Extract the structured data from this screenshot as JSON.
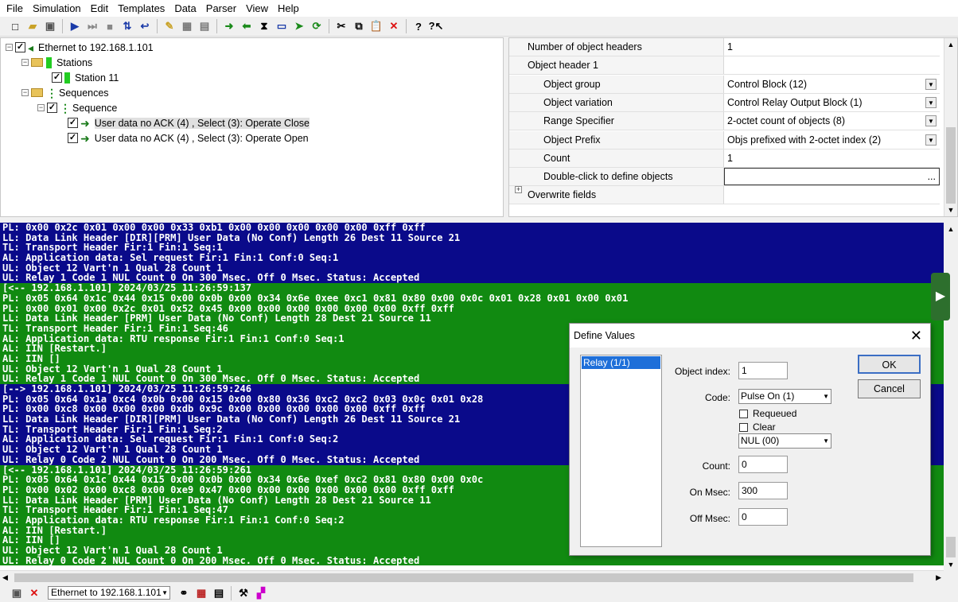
{
  "menu": [
    "File",
    "Simulation",
    "Edit",
    "Templates",
    "Data",
    "Parser",
    "View",
    "Help"
  ],
  "toolbar_icons": [
    "new-icon",
    "open-icon",
    "save-icon",
    "play-icon",
    "step-icon",
    "stop-icon",
    "sort-icon",
    "loop-icon",
    "tool-icon",
    "grid-icon",
    "grid2-icon",
    "go-right-icon",
    "go-left-icon",
    "hourglass-icon",
    "monitor-icon",
    "go-icon",
    "refresh-icon",
    "cut-icon",
    "copy-icon",
    "paste-icon",
    "delete-icon",
    "help-icon",
    "whatsthis-icon"
  ],
  "tree": {
    "root": "Ethernet to 192.168.1.101",
    "stations": "Stations",
    "station11": "Station 11",
    "sequences": "Sequences",
    "sequence": "Sequence",
    "item1": "User data no ACK (4) , Select (3): Operate Close",
    "item2": "User data no ACK (4) , Select (3): Operate Open"
  },
  "props": [
    {
      "name": "Number of object headers",
      "value": "1",
      "indent": false,
      "dropdown": false
    },
    {
      "name": "Object header 1",
      "value": "",
      "indent": false,
      "dropdown": false
    },
    {
      "name": "Object group",
      "value": "Control Block (12)",
      "indent": true,
      "dropdown": true
    },
    {
      "name": "Object variation",
      "value": "Control Relay Output Block (1)",
      "indent": true,
      "dropdown": true
    },
    {
      "name": "Range Specifier",
      "value": "2-octet count of objects (8)",
      "indent": true,
      "dropdown": true
    },
    {
      "name": "Object Prefix",
      "value": "Objs prefixed with 2-octet index (2)",
      "indent": true,
      "dropdown": true
    },
    {
      "name": "Count",
      "value": "1",
      "indent": true,
      "dropdown": false
    },
    {
      "name": "Double-click to define objects",
      "value": "",
      "indent": true,
      "dropdown": false
    },
    {
      "name": "Overwrite fields",
      "value": "",
      "indent": false,
      "dropdown": false
    }
  ],
  "log": [
    {
      "c": "blue",
      "t": "PL: 0x00 0x2c 0x01 0x00 0x00 0x33 0xb1 0x00 0x00 0x00 0x00 0x00 0xff 0xff"
    },
    {
      "c": "blue",
      "t": "LL: Data Link Header [DIR][PRM] User Data (No Conf) Length 26 Dest 11 Source 21"
    },
    {
      "c": "blue",
      "t": "TL: Transport Header Fir:1 Fin:1 Seq:1"
    },
    {
      "c": "blue",
      "t": "AL: Application data: Sel request Fir:1 Fin:1 Conf:0 Seq:1"
    },
    {
      "c": "blue",
      "t": "UL: Object 12 Vart'n 1 Qual 28 Count 1"
    },
    {
      "c": "blue",
      "t": "UL: Relay 1 Code 1 NUL Count 0 On 300 Msec. Off 0 Msec. Status: Accepted"
    },
    {
      "c": "green",
      "t": "[<-- 192.168.1.101] 2024/03/25 11:26:59:137"
    },
    {
      "c": "green",
      "t": "PL: 0x05 0x64 0x1c 0x44 0x15 0x00 0x0b 0x00 0x34 0x6e 0xee 0xc1 0x81 0x80 0x00 0x0c 0x01 0x28 0x01 0x00 0x01"
    },
    {
      "c": "green",
      "t": "PL: 0x00 0x01 0x00 0x2c 0x01 0x52 0x45 0x00 0x00 0x00 0x00 0x00 0x00 0xff 0xff"
    },
    {
      "c": "green",
      "t": "LL: Data Link Header [PRM] User Data (No Conf) Length 28 Dest 21 Source 11"
    },
    {
      "c": "green",
      "t": "TL: Transport Header Fir:1 Fin:1 Seq:46"
    },
    {
      "c": "green",
      "t": "AL: Application data: RTU response Fir:1 Fin:1 Conf:0 Seq:1"
    },
    {
      "c": "green",
      "t": "AL: IIN [Restart.]"
    },
    {
      "c": "green",
      "t": "AL: IIN []"
    },
    {
      "c": "green",
      "t": "UL: Object 12 Vart'n 1 Qual 28 Count 1"
    },
    {
      "c": "green",
      "t": "UL: Relay 1 Code 1 NUL Count 0 On 300 Msec. Off 0 Msec. Status: Accepted"
    },
    {
      "c": "blue",
      "t": "[--> 192.168.1.101] 2024/03/25 11:26:59:246"
    },
    {
      "c": "blue",
      "t": "PL: 0x05 0x64 0x1a 0xc4 0x0b 0x00 0x15 0x00 0x80 0x36 0xc2 0xc2 0x03 0x0c 0x01 0x28"
    },
    {
      "c": "blue",
      "t": "PL: 0x00 0xc8 0x00 0x00 0x00 0xdb 0x9c 0x00 0x00 0x00 0x00 0x00 0xff 0xff"
    },
    {
      "c": "blue",
      "t": "LL: Data Link Header [DIR][PRM] User Data (No Conf) Length 26 Dest 11 Source 21"
    },
    {
      "c": "blue",
      "t": "TL: Transport Header Fir:1 Fin:1 Seq:2"
    },
    {
      "c": "blue",
      "t": "AL: Application data: Sel request Fir:1 Fin:1 Conf:0 Seq:2"
    },
    {
      "c": "blue",
      "t": "UL: Object 12 Vart'n 1 Qual 28 Count 1"
    },
    {
      "c": "blue",
      "t": "UL: Relay 0 Code 2 NUL Count 0 On 200 Msec. Off 0 Msec. Status: Accepted"
    },
    {
      "c": "green",
      "t": "[<-- 192.168.1.101] 2024/03/25 11:26:59:261"
    },
    {
      "c": "green",
      "t": "PL: 0x05 0x64 0x1c 0x44 0x15 0x00 0x0b 0x00 0x34 0x6e 0xef 0xc2 0x81 0x80 0x00 0x0c"
    },
    {
      "c": "green",
      "t": "PL: 0x00 0x02 0x00 0xc8 0x00 0xe9 0x47 0x00 0x00 0x00 0x00 0x00 0x00 0xff 0xff"
    },
    {
      "c": "green",
      "t": "LL: Data Link Header [PRM] User Data (No Conf) Length 28 Dest 21 Source 11"
    },
    {
      "c": "green",
      "t": "TL: Transport Header Fir:1 Fin:1 Seq:47"
    },
    {
      "c": "green",
      "t": "AL: Application data: RTU response Fir:1 Fin:1 Conf:0 Seq:2"
    },
    {
      "c": "green",
      "t": "AL: IIN [Restart.]"
    },
    {
      "c": "green",
      "t": "AL: IIN []"
    },
    {
      "c": "green",
      "t": "UL: Object 12 Vart'n 1 Qual 28 Count 1"
    },
    {
      "c": "green",
      "t": "UL: Relay 0 Code 2 NUL Count 0 On 200 Msec. Off 0 Msec. Status: Accepted"
    }
  ],
  "dialog": {
    "title": "Define Values",
    "list_item": "Relay (1/1)",
    "object_index_label": "Object index:",
    "object_index": "1",
    "code_label": "Code:",
    "code": "Pulse On (1)",
    "requeued": "Requeued",
    "clear": "Clear",
    "nul": "NUL (00)",
    "count_label": "Count:",
    "count": "0",
    "on_label": "On Msec:",
    "on": "300",
    "off_label": "Off Msec:",
    "off": "0",
    "ok": "OK",
    "cancel": "Cancel"
  },
  "statusbar": {
    "connection": "Ethernet to 192.168.1.101"
  },
  "colors": {
    "log_blue": "#0a0a8a",
    "log_green": "#118a11",
    "selection": "#1e6fd9"
  }
}
